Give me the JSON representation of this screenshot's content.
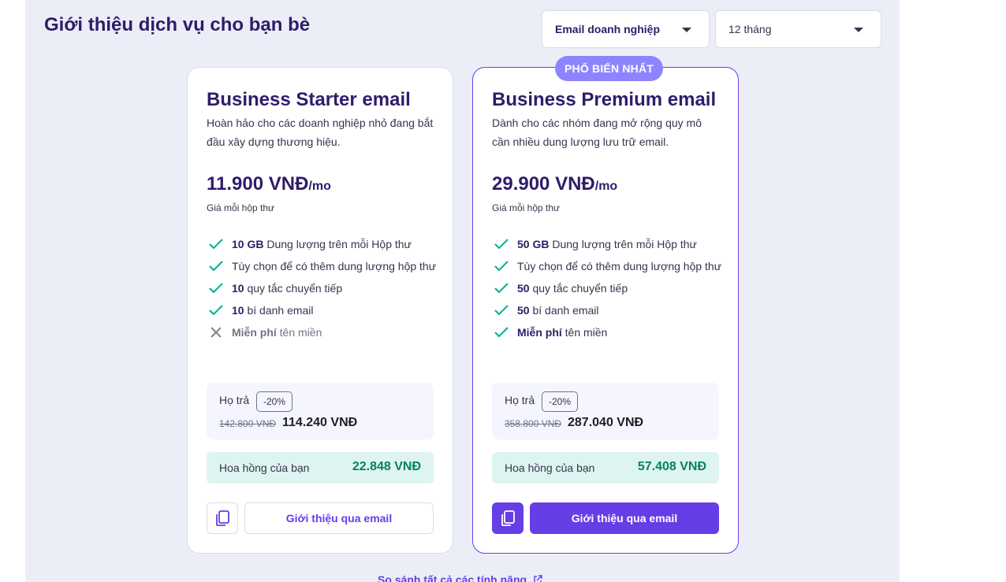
{
  "page": {
    "title": "Giới thiệu dịch vụ cho bạn bè"
  },
  "filters": {
    "product": "Email doanh nghiệp",
    "period": "12 tháng"
  },
  "colors": {
    "accent": "#673de6",
    "badge": "#8c85ff",
    "commission_bg": "#def4f0",
    "commission_text": "#008361",
    "check": "#00b090"
  },
  "plans": [
    {
      "name": "Business Starter email",
      "description": "Hoàn hảo cho các doanh nghiệp nhỏ đang bắt đầu xây dựng thương hiệu.",
      "price": "11.900 VNĐ",
      "per": "/mo",
      "price_note": "Giá mỗi hộp thư",
      "features": [
        {
          "bold": "10 GB",
          "text": " Dung lượng trên mỗi Hộp thư",
          "included": true
        },
        {
          "bold": "",
          "text": "Tùy chọn để có thêm dung lượng hộp thư",
          "included": true
        },
        {
          "bold": "10",
          "text": " quy tắc chuyển tiếp",
          "included": true
        },
        {
          "bold": "10",
          "text": " bí danh email",
          "included": true
        },
        {
          "bold": "Miễn phí",
          "text": " tên miền",
          "included": false
        }
      ],
      "pay_label": "Họ trả",
      "discount": "-20%",
      "old_price": "142.800 VNĐ",
      "new_price": "114.240 VNĐ",
      "commission_label": "Hoa hồng của bạn",
      "commission_value": "22.848 VNĐ",
      "refer_button": "Giới thiệu qua email"
    },
    {
      "badge": "PHỔ BIẾN NHẤT",
      "name": "Business Premium email",
      "description": "Dành cho các nhóm đang mở rộng quy mô cần nhiều dung lượng lưu trữ email.",
      "price": "29.900 VNĐ",
      "per": "/mo",
      "price_note": "Giá mỗi hộp thư",
      "features": [
        {
          "bold": "50 GB",
          "text": " Dung lượng trên mỗi Hộp thư",
          "included": true
        },
        {
          "bold": "",
          "text": "Tùy chọn để có thêm dung lượng hộp thư",
          "included": true
        },
        {
          "bold": "50",
          "text": " quy tắc chuyển tiếp",
          "included": true
        },
        {
          "bold": "50",
          "text": " bí danh email",
          "included": true
        },
        {
          "bold": "Miễn phí",
          "text": " tên miền",
          "included": true
        }
      ],
      "pay_label": "Họ trả",
      "discount": "-20%",
      "old_price": "358.800 VNĐ",
      "new_price": "287.040 VNĐ",
      "commission_label": "Hoa hồng của bạn",
      "commission_value": "57.408 VNĐ",
      "refer_button": "Giới thiệu qua email"
    }
  ],
  "compare_link": "So sánh tất cả các tính năng"
}
